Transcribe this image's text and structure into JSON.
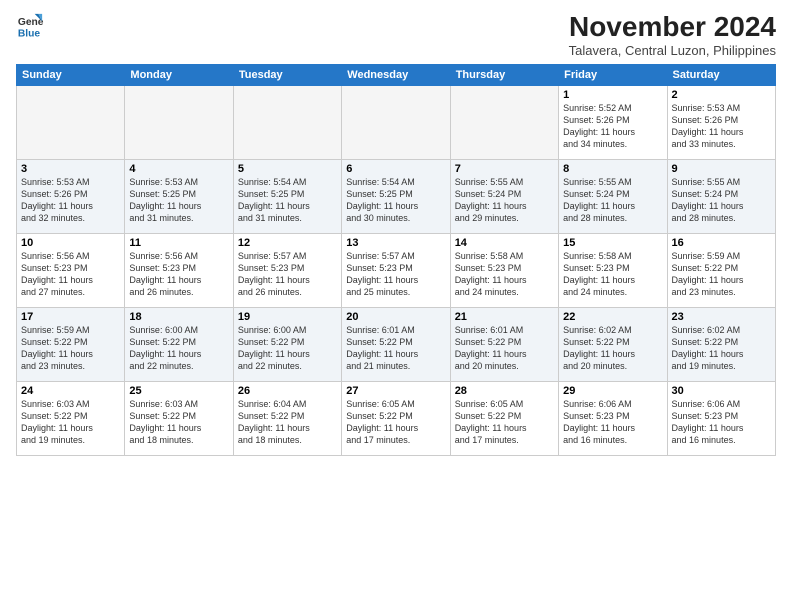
{
  "logo": {
    "line1": "General",
    "line2": "Blue"
  },
  "title": "November 2024",
  "location": "Talavera, Central Luzon, Philippines",
  "weekdays": [
    "Sunday",
    "Monday",
    "Tuesday",
    "Wednesday",
    "Thursday",
    "Friday",
    "Saturday"
  ],
  "weeks": [
    [
      {
        "day": "",
        "info": ""
      },
      {
        "day": "",
        "info": ""
      },
      {
        "day": "",
        "info": ""
      },
      {
        "day": "",
        "info": ""
      },
      {
        "day": "",
        "info": ""
      },
      {
        "day": "1",
        "info": "Sunrise: 5:52 AM\nSunset: 5:26 PM\nDaylight: 11 hours\nand 34 minutes."
      },
      {
        "day": "2",
        "info": "Sunrise: 5:53 AM\nSunset: 5:26 PM\nDaylight: 11 hours\nand 33 minutes."
      }
    ],
    [
      {
        "day": "3",
        "info": "Sunrise: 5:53 AM\nSunset: 5:26 PM\nDaylight: 11 hours\nand 32 minutes."
      },
      {
        "day": "4",
        "info": "Sunrise: 5:53 AM\nSunset: 5:25 PM\nDaylight: 11 hours\nand 31 minutes."
      },
      {
        "day": "5",
        "info": "Sunrise: 5:54 AM\nSunset: 5:25 PM\nDaylight: 11 hours\nand 31 minutes."
      },
      {
        "day": "6",
        "info": "Sunrise: 5:54 AM\nSunset: 5:25 PM\nDaylight: 11 hours\nand 30 minutes."
      },
      {
        "day": "7",
        "info": "Sunrise: 5:55 AM\nSunset: 5:24 PM\nDaylight: 11 hours\nand 29 minutes."
      },
      {
        "day": "8",
        "info": "Sunrise: 5:55 AM\nSunset: 5:24 PM\nDaylight: 11 hours\nand 28 minutes."
      },
      {
        "day": "9",
        "info": "Sunrise: 5:55 AM\nSunset: 5:24 PM\nDaylight: 11 hours\nand 28 minutes."
      }
    ],
    [
      {
        "day": "10",
        "info": "Sunrise: 5:56 AM\nSunset: 5:23 PM\nDaylight: 11 hours\nand 27 minutes."
      },
      {
        "day": "11",
        "info": "Sunrise: 5:56 AM\nSunset: 5:23 PM\nDaylight: 11 hours\nand 26 minutes."
      },
      {
        "day": "12",
        "info": "Sunrise: 5:57 AM\nSunset: 5:23 PM\nDaylight: 11 hours\nand 26 minutes."
      },
      {
        "day": "13",
        "info": "Sunrise: 5:57 AM\nSunset: 5:23 PM\nDaylight: 11 hours\nand 25 minutes."
      },
      {
        "day": "14",
        "info": "Sunrise: 5:58 AM\nSunset: 5:23 PM\nDaylight: 11 hours\nand 24 minutes."
      },
      {
        "day": "15",
        "info": "Sunrise: 5:58 AM\nSunset: 5:23 PM\nDaylight: 11 hours\nand 24 minutes."
      },
      {
        "day": "16",
        "info": "Sunrise: 5:59 AM\nSunset: 5:22 PM\nDaylight: 11 hours\nand 23 minutes."
      }
    ],
    [
      {
        "day": "17",
        "info": "Sunrise: 5:59 AM\nSunset: 5:22 PM\nDaylight: 11 hours\nand 23 minutes."
      },
      {
        "day": "18",
        "info": "Sunrise: 6:00 AM\nSunset: 5:22 PM\nDaylight: 11 hours\nand 22 minutes."
      },
      {
        "day": "19",
        "info": "Sunrise: 6:00 AM\nSunset: 5:22 PM\nDaylight: 11 hours\nand 22 minutes."
      },
      {
        "day": "20",
        "info": "Sunrise: 6:01 AM\nSunset: 5:22 PM\nDaylight: 11 hours\nand 21 minutes."
      },
      {
        "day": "21",
        "info": "Sunrise: 6:01 AM\nSunset: 5:22 PM\nDaylight: 11 hours\nand 20 minutes."
      },
      {
        "day": "22",
        "info": "Sunrise: 6:02 AM\nSunset: 5:22 PM\nDaylight: 11 hours\nand 20 minutes."
      },
      {
        "day": "23",
        "info": "Sunrise: 6:02 AM\nSunset: 5:22 PM\nDaylight: 11 hours\nand 19 minutes."
      }
    ],
    [
      {
        "day": "24",
        "info": "Sunrise: 6:03 AM\nSunset: 5:22 PM\nDaylight: 11 hours\nand 19 minutes."
      },
      {
        "day": "25",
        "info": "Sunrise: 6:03 AM\nSunset: 5:22 PM\nDaylight: 11 hours\nand 18 minutes."
      },
      {
        "day": "26",
        "info": "Sunrise: 6:04 AM\nSunset: 5:22 PM\nDaylight: 11 hours\nand 18 minutes."
      },
      {
        "day": "27",
        "info": "Sunrise: 6:05 AM\nSunset: 5:22 PM\nDaylight: 11 hours\nand 17 minutes."
      },
      {
        "day": "28",
        "info": "Sunrise: 6:05 AM\nSunset: 5:22 PM\nDaylight: 11 hours\nand 17 minutes."
      },
      {
        "day": "29",
        "info": "Sunrise: 6:06 AM\nSunset: 5:23 PM\nDaylight: 11 hours\nand 16 minutes."
      },
      {
        "day": "30",
        "info": "Sunrise: 6:06 AM\nSunset: 5:23 PM\nDaylight: 11 hours\nand 16 minutes."
      }
    ]
  ]
}
